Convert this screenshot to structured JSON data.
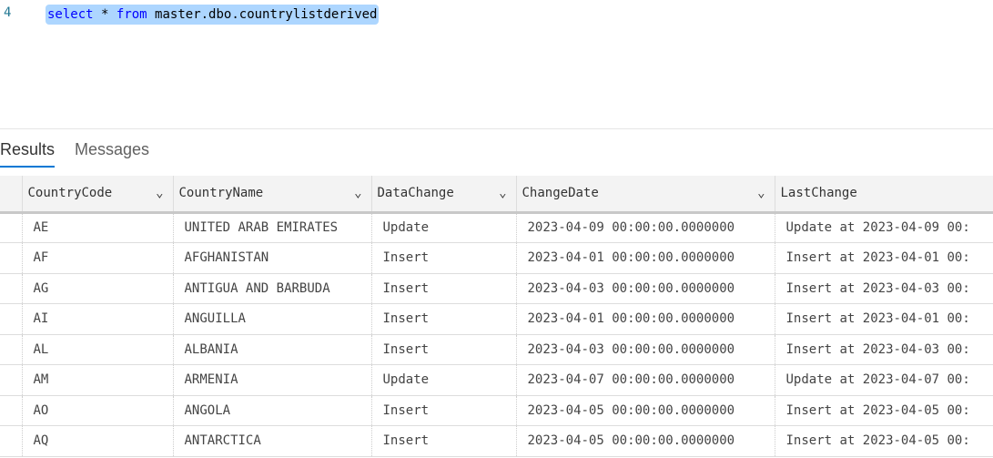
{
  "editor": {
    "line_number": "4",
    "kw_select": "select",
    "star": "*",
    "kw_from": "from",
    "table_ref": "master.dbo.countrylistderived"
  },
  "tabs": [
    {
      "label": "Results"
    },
    {
      "label": "Messages"
    }
  ],
  "columns": [
    "CountryCode",
    "CountryName",
    "DataChange",
    "ChangeDate",
    "LastChange"
  ],
  "rows": [
    [
      "AE",
      "UNITED ARAB EMIRATES",
      "Update",
      "2023-04-09 00:00:00.0000000",
      "Update at 2023-04-09 00:"
    ],
    [
      "AF",
      "AFGHANISTAN",
      "Insert",
      "2023-04-01 00:00:00.0000000",
      "Insert at 2023-04-01 00:"
    ],
    [
      "AG",
      "ANTIGUA AND BARBUDA",
      "Insert",
      "2023-04-03 00:00:00.0000000",
      "Insert at 2023-04-03 00:"
    ],
    [
      "AI",
      "ANGUILLA",
      "Insert",
      "2023-04-01 00:00:00.0000000",
      "Insert at 2023-04-01 00:"
    ],
    [
      "AL",
      "ALBANIA",
      "Insert",
      "2023-04-03 00:00:00.0000000",
      "Insert at 2023-04-03 00:"
    ],
    [
      "AM",
      "ARMENIA",
      "Update",
      "2023-04-07 00:00:00.0000000",
      "Update at 2023-04-07 00:"
    ],
    [
      "AO",
      "ANGOLA",
      "Insert",
      "2023-04-05 00:00:00.0000000",
      "Insert at 2023-04-05 00:"
    ],
    [
      "AQ",
      "ANTARCTICA",
      "Insert",
      "2023-04-05 00:00:00.0000000",
      "Insert at 2023-04-05 00:"
    ]
  ]
}
